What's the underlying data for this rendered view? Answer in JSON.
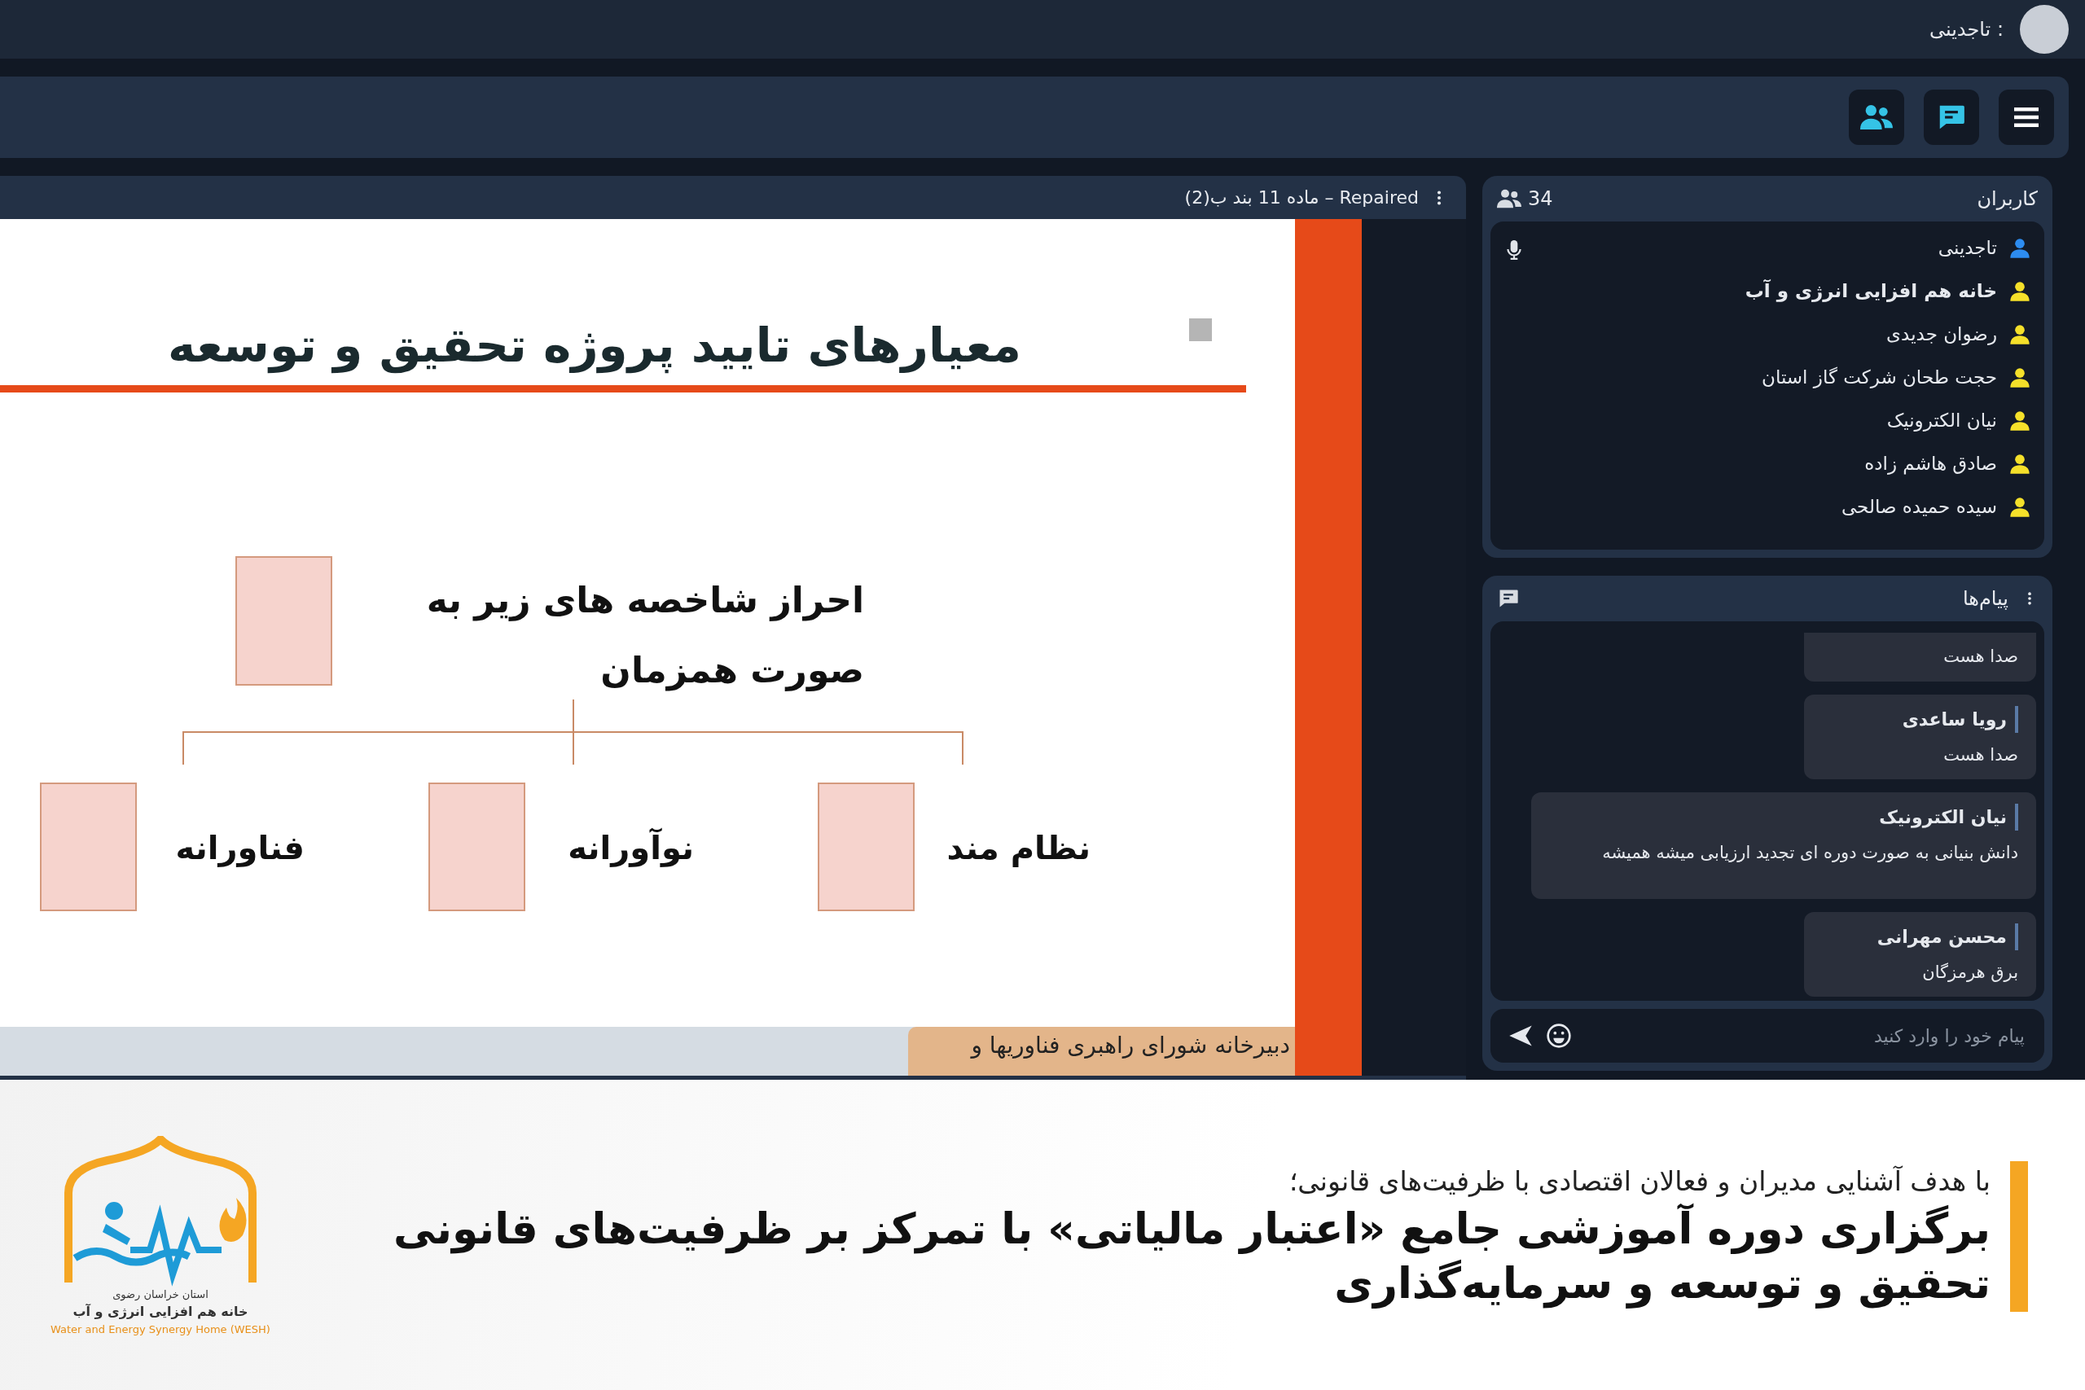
{
  "top_bar": {
    "user_label": "تاجدینی :"
  },
  "presentation": {
    "title": "ماده 11 بند ب(2) – Repaired",
    "slide": {
      "title": "معیارهای تایید پروژه تحقیق و توسعه",
      "center_lines": [
        "احراز شاخصه های زیر به",
        "صورت همزمان"
      ],
      "branches": [
        "نظام مند",
        "نوآورانه",
        "فناورانه"
      ],
      "footer": "دبیرخانه شورای راهبری فناوریها و"
    }
  },
  "users_panel": {
    "title": "کاربران",
    "count": "34",
    "users": [
      {
        "name": "تاجدینی",
        "color": "#2d8cf0",
        "bold": false
      },
      {
        "name": "خانه هم افزایی انرژی و آب",
        "color": "#f5e02a",
        "bold": true
      },
      {
        "name": "رضوان جدیدی",
        "color": "#f5e02a",
        "bold": false
      },
      {
        "name": "حجت طحان شرکت گاز استان",
        "color": "#f5e02a",
        "bold": false
      },
      {
        "name": "نیان الکترونیک",
        "color": "#f5e02a",
        "bold": false
      },
      {
        "name": "صادق هاشم زاده",
        "color": "#f5e02a",
        "bold": false
      },
      {
        "name": "سیده حمیده صالحی",
        "color": "#f5e02a",
        "bold": false
      }
    ]
  },
  "messages_panel": {
    "title": "پیام‌ها",
    "messages": [
      {
        "text": "صدا هست",
        "wide": false
      },
      {
        "sender": "رویا ساعدی",
        "text": "صدا هست",
        "wide": false
      },
      {
        "sender": "نیان الکترونیک",
        "text": "دانش بنیانی به صورت دوره ای تجدید ارزیابی میشه همیشه",
        "wide": true
      },
      {
        "sender": "محسن مهرانی",
        "text": "برق هرمزگان",
        "wide": false
      }
    ],
    "input": {
      "placeholder": "پیام خود را وارد کنید"
    }
  },
  "banner": {
    "subtitle": "با هدف آشنایی مدیران و فعالان اقتصادی با ظرفیت‌های قانونی؛",
    "headline_lines": [
      "برگزاری دوره آموزشی جامع «اعتبار مالیاتی» با تمرکز بر ظرفیت‌های قانونی",
      "تحقیق و توسعه و سرمایه‌گذاری"
    ],
    "logo": {
      "province": "استان خراسان رضوی",
      "name": "خانه هم افزایی انرژی و آب",
      "english": "Water and Energy Synergy Home (WESH)"
    }
  }
}
